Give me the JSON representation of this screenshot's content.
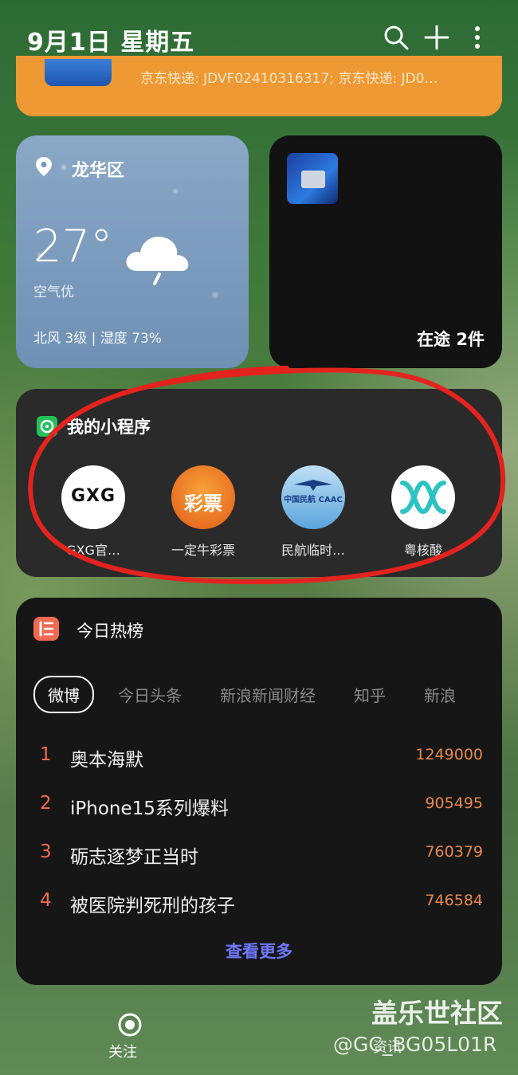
{
  "header": {
    "date": "9月1日 星期五",
    "icons": [
      "search-icon",
      "plus-icon",
      "more-vertical-icon"
    ]
  },
  "express_card": {
    "text": "京东快递: JDVF02410316317; 京东快递: JD0…"
  },
  "weather": {
    "district": "龙华区",
    "temperature": "27°",
    "air_quality": "空气优",
    "wind_humidity": "北风 3级 | 湿度 73%",
    "icon": "cloudy-rain-icon"
  },
  "delivery": {
    "status": "在途 2件"
  },
  "mini_programs": {
    "title": "我的小程序",
    "apps": [
      {
        "label": "GXG官…",
        "logo": "GXG"
      },
      {
        "label": "一定牛彩票",
        "logo": "彩票"
      },
      {
        "label": "民航临时…",
        "logo": "中国民航 CAAC"
      },
      {
        "label": "粤核酸",
        "logo": "dna-icon"
      }
    ]
  },
  "hot_list": {
    "title": "今日热榜",
    "tabs": [
      "微博",
      "今日头条",
      "新浪新闻财经",
      "知乎",
      "新浪"
    ],
    "active_tab": "微博",
    "items": [
      {
        "rank": "1",
        "title": "奥本海默",
        "count": "1249000"
      },
      {
        "rank": "2",
        "title": "iPhone15系列爆料",
        "count": "905495"
      },
      {
        "rank": "3",
        "title": "砺志逐梦正当时",
        "count": "760379"
      },
      {
        "rank": "4",
        "title": "被医院判死刑的孩子",
        "count": "746584"
      }
    ],
    "more_label": "查看更多"
  },
  "bottom_nav": {
    "follow_label": "关注",
    "second_label": "资讯"
  },
  "watermark": {
    "line1": "盖乐世社区",
    "line2": "@GC_BG05L01R"
  },
  "colors": {
    "accent_orange": "#ee9933",
    "rank_red": "#f06a52",
    "count_orange": "#e7894b",
    "link_blue": "#6f78ff"
  }
}
